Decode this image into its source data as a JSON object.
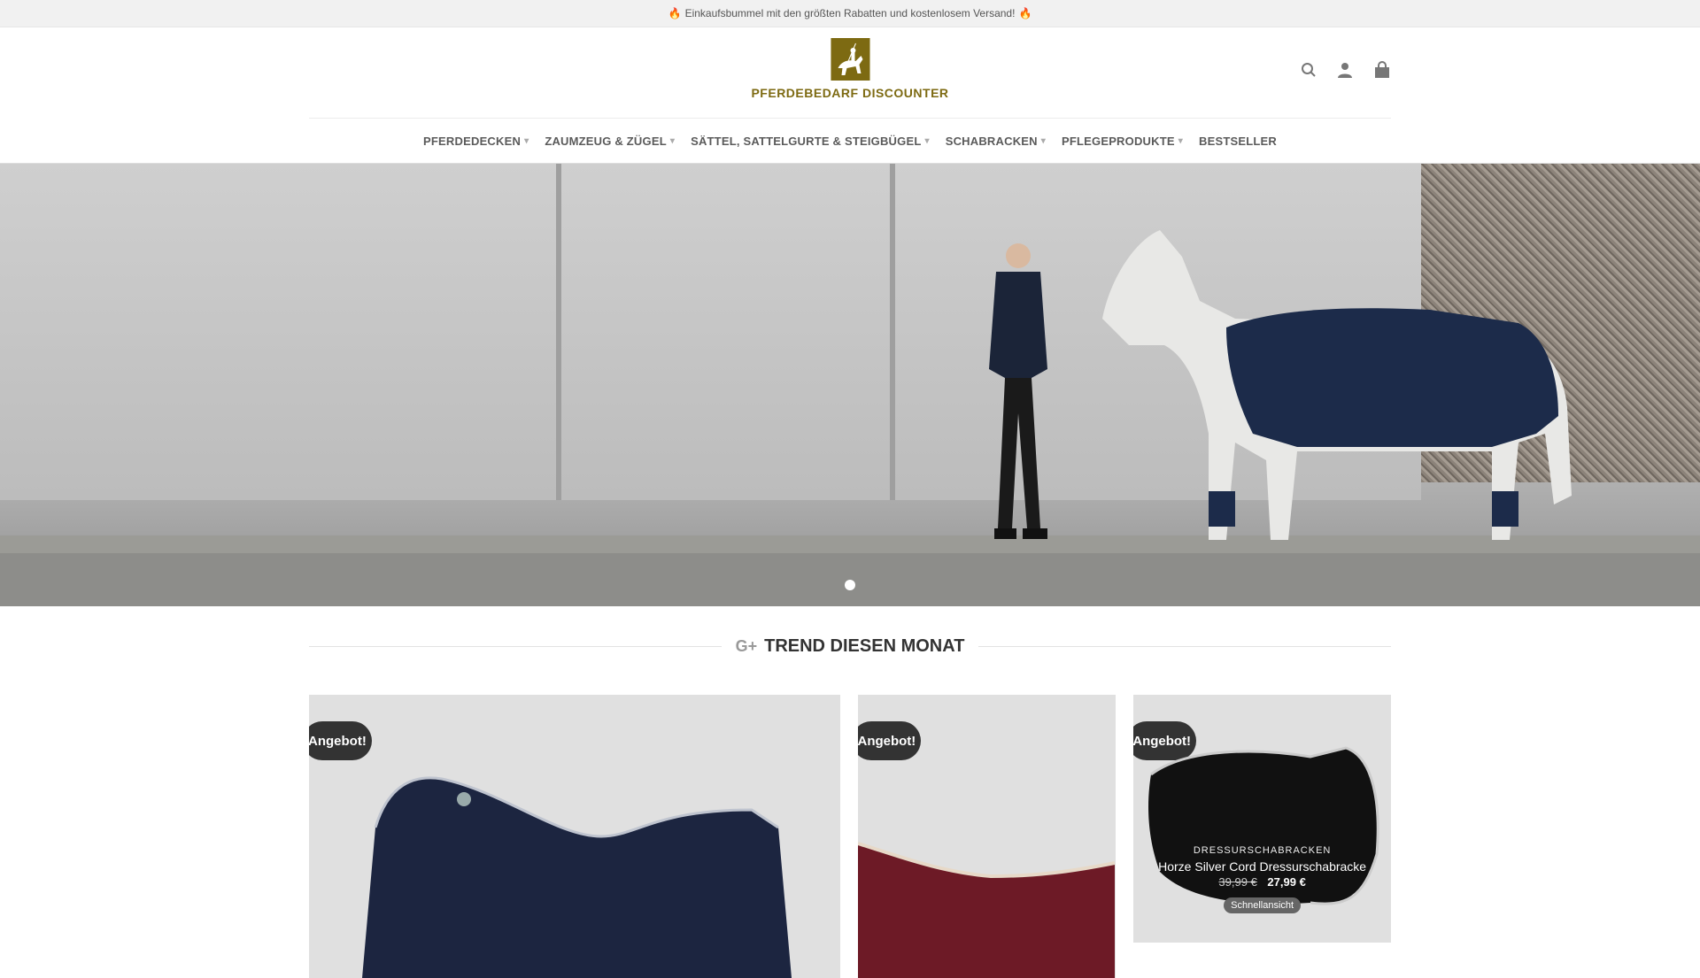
{
  "topbar": {
    "text": "Einkaufsbummel mit den größten Rabatten und kostenlosem Versand!"
  },
  "header": {
    "logo_text": "PFERDEBEDARF DISCOUNTER",
    "icons": [
      "search-icon",
      "account-icon",
      "cart-icon"
    ],
    "brand_color": "#7d6a12"
  },
  "nav": {
    "items": [
      {
        "label": "PFERDEDECKEN",
        "has_dropdown": true
      },
      {
        "label": "ZAUMZEUG & ZÜGEL",
        "has_dropdown": true
      },
      {
        "label": "SÄTTEL, SATTELGURTE & STEIGBÜGEL",
        "has_dropdown": true
      },
      {
        "label": "SCHABRACKEN",
        "has_dropdown": true
      },
      {
        "label": "PFLEGEPRODUKTE",
        "has_dropdown": true
      },
      {
        "label": "BESTSELLER",
        "has_dropdown": false
      }
    ]
  },
  "hero": {
    "slides_count": 1,
    "active_slide": 1
  },
  "trend": {
    "title": "TREND DIESEN MONAT",
    "icon": "gplus-icon"
  },
  "products": [
    {
      "badge": "Angebot!"
    },
    {
      "badge": "Angebot!"
    },
    {
      "badge": "Angebot!",
      "category": "DRESSURSCHABRACKEN",
      "name": "Horze Silver Cord Dressurschabracke",
      "old_price": "39,99 €",
      "new_price": "27,99 €",
      "quick_view": "Schnellansicht"
    }
  ]
}
